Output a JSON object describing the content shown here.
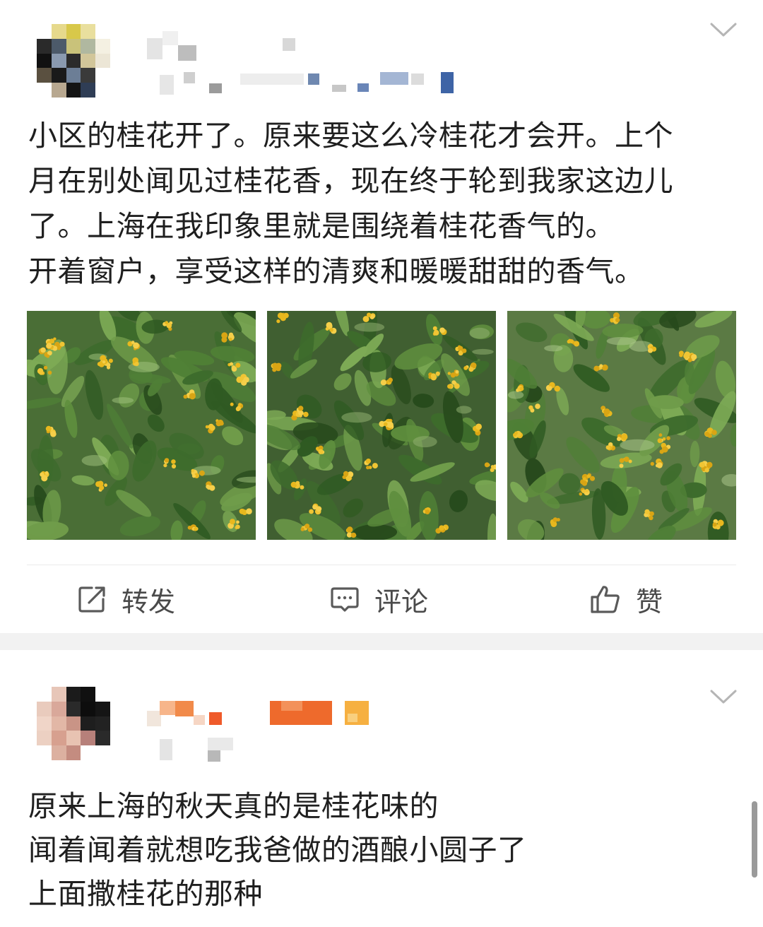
{
  "feed": {
    "posts": [
      {
        "text": "小区的桂花开了。原来要这么冷桂花才会开。上个\n月在别处闻见过桂花香，现在终于轮到我家这边儿\n了。上海在我印象里就是围绕着桂花香气的。\n开着窗户，享受这样的清爽和暖暖甜甜的香气。",
        "menu_icon": "chevron-down-icon",
        "photos": [
          {
            "icon": "osmanthus-photo"
          },
          {
            "icon": "osmanthus-photo"
          },
          {
            "icon": "osmanthus-photo"
          }
        ],
        "actions": {
          "repost": {
            "label": "转发",
            "icon": "share-icon"
          },
          "comment": {
            "label": "评论",
            "icon": "comment-icon"
          },
          "like": {
            "label": "赞",
            "icon": "thumbs-up-icon"
          }
        }
      },
      {
        "text": "原来上海的秋天真的是桂花味的\n闻着闻着就想吃我爸做的酒酿小圆子了\n上面撒桂花的那种",
        "menu_icon": "chevron-down-icon"
      }
    ]
  },
  "colors": {
    "text": "#1f1f1f",
    "action_text": "#4a4a4a",
    "separator": "#f2f2f2",
    "flower_yellow": "#e8b81e",
    "leaf_green": "#3d6b2c"
  }
}
